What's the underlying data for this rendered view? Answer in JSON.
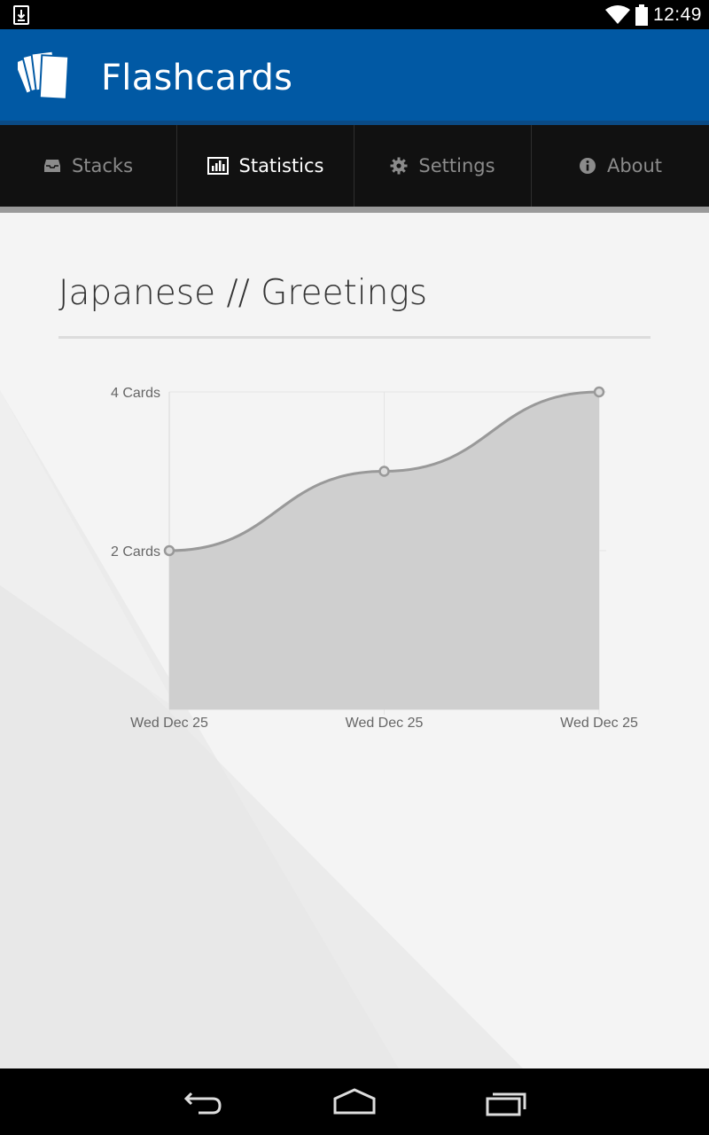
{
  "status_bar": {
    "time": "12:49",
    "icons": [
      "download-notification-icon",
      "wifi-icon",
      "battery-icon"
    ]
  },
  "app_bar": {
    "title": "Flashcards",
    "logo_icon": "flashcards-logo-icon",
    "color": "#0159a4"
  },
  "tabs": [
    {
      "label": "Stacks",
      "icon": "inbox-icon",
      "active": false
    },
    {
      "label": "Statistics",
      "icon": "bar-chart-icon",
      "active": true
    },
    {
      "label": "Settings",
      "icon": "gear-icon",
      "active": false
    },
    {
      "label": "About",
      "icon": "info-icon",
      "active": false
    }
  ],
  "accent_color": "#1fa4d8",
  "main": {
    "stack_title": "Japanese // Greetings"
  },
  "chart_data": {
    "type": "area",
    "x": [
      "Wed Dec 25",
      "Wed Dec 25",
      "Wed Dec 25"
    ],
    "values": [
      2,
      3,
      4
    ],
    "y_ticks": [
      {
        "value": 2,
        "label": "2 Cards"
      },
      {
        "value": 4,
        "label": "4 Cards"
      }
    ],
    "ylim": [
      0,
      4
    ],
    "grid": true,
    "fill_color": "#cfcfcf",
    "line_color": "#999999"
  },
  "nav_bar": {
    "buttons": [
      "back-icon",
      "home-icon",
      "recent-apps-icon"
    ]
  }
}
